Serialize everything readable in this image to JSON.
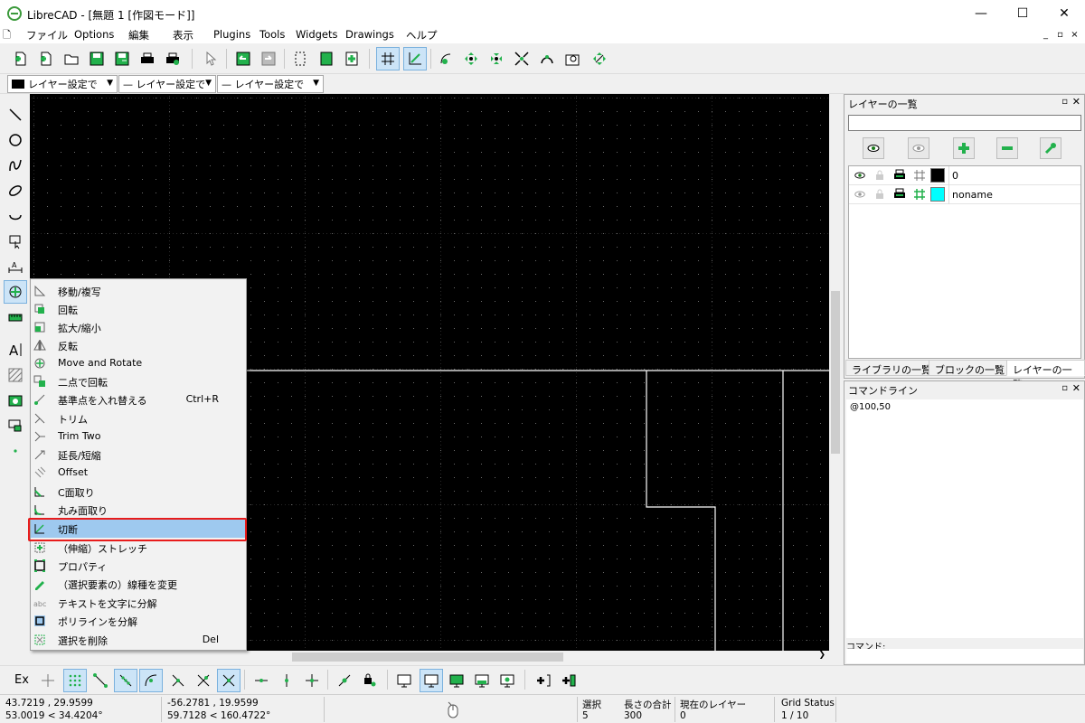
{
  "window": {
    "title": "LibreCAD - [無題 1 [作図モード]]",
    "minimize": "—",
    "maximize": "☐",
    "close": "✕"
  },
  "menu": {
    "items": [
      "ファイル",
      "Options",
      "編集",
      "表示",
      "Plugins",
      "Tools",
      "Widgets",
      "Drawings",
      "ヘルプ"
    ],
    "mdi_buttons": [
      "_",
      "▫",
      "×"
    ]
  },
  "pen_toolbar": {
    "color_label": "レイヤー設定で",
    "width_label": "— レイヤー設定で",
    "type_label": "— レイヤー設定で"
  },
  "layer_dock": {
    "title": "レイヤーの一覧",
    "rows": [
      {
        "name": "0",
        "color": "#000000",
        "visible": true
      },
      {
        "name": "noname",
        "color": "#00ffff",
        "visible": false
      }
    ]
  },
  "dock_tabs": [
    "ライブラリの一覧",
    "ブロックの一覧",
    "レイヤーの一覧"
  ],
  "command_dock": {
    "title": "コマンドライン",
    "history": "@100,50",
    "input_label": "コマンド:"
  },
  "bottom_toolbar": {
    "ex_label": "Ex"
  },
  "status": {
    "abs_coord": "43.7219 , 29.9599",
    "abs_polar": "53.0019 < 34.4204°",
    "rel_coord": "-56.2781 , 19.9599",
    "rel_polar": "59.7128 < 160.4722°",
    "selected_label": "選択",
    "selected_value": "5",
    "length_label": "長さの合計",
    "length_value": "300",
    "layer_label": "現在のレイヤー",
    "layer_value": "0",
    "grid_label": "Grid Status",
    "grid_value": "1 / 10"
  },
  "context_menu": {
    "items": [
      {
        "label": "移動/複写",
        "shortcut": "",
        "icon": "move-copy-icon"
      },
      {
        "label": "回転",
        "shortcut": "",
        "icon": "rotate-icon"
      },
      {
        "label": "拡大/縮小",
        "shortcut": "",
        "icon": "scale-icon"
      },
      {
        "label": "反転",
        "shortcut": "",
        "icon": "mirror-icon"
      },
      {
        "label": "Move and Rotate",
        "shortcut": "",
        "icon": "move-rotate-icon"
      },
      {
        "label": "二点で回転",
        "shortcut": "",
        "icon": "rotate-two-icon"
      },
      {
        "label": "基準点を入れ替える",
        "shortcut": "Ctrl+R",
        "icon": "revert-direction-icon"
      },
      {
        "label": "トリム",
        "shortcut": "",
        "icon": "trim-icon"
      },
      {
        "label": "Trim Two",
        "shortcut": "",
        "icon": "trim-two-icon"
      },
      {
        "label": "延長/短縮",
        "shortcut": "",
        "icon": "lengthen-icon"
      },
      {
        "label": "Offset",
        "shortcut": "",
        "icon": "offset-icon"
      },
      {
        "label": "C面取り",
        "shortcut": "",
        "icon": "bevel-icon"
      },
      {
        "label": "丸み面取り",
        "shortcut": "",
        "icon": "fillet-icon"
      },
      {
        "label": "切断",
        "shortcut": "",
        "icon": "cut-icon"
      },
      {
        "label": "（伸縮）ストレッチ",
        "shortcut": "",
        "icon": "stretch-icon"
      },
      {
        "label": "プロパティ",
        "shortcut": "",
        "icon": "properties-icon"
      },
      {
        "label": "（選択要素の）線種を変更",
        "shortcut": "",
        "icon": "attributes-icon"
      },
      {
        "label": "テキストを文字に分解",
        "shortcut": "",
        "icon": "explode-text-icon"
      },
      {
        "label": "ポリラインを分解",
        "shortcut": "",
        "icon": "explode-polyline-icon"
      },
      {
        "label": "選択を削除",
        "shortcut": "Del",
        "icon": "delete-icon"
      }
    ],
    "highlighted_index": 13
  },
  "colors": {
    "accent_green": "#22b14c",
    "highlight_red": "#e81c1c",
    "selection_blue": "#cce4f7"
  }
}
